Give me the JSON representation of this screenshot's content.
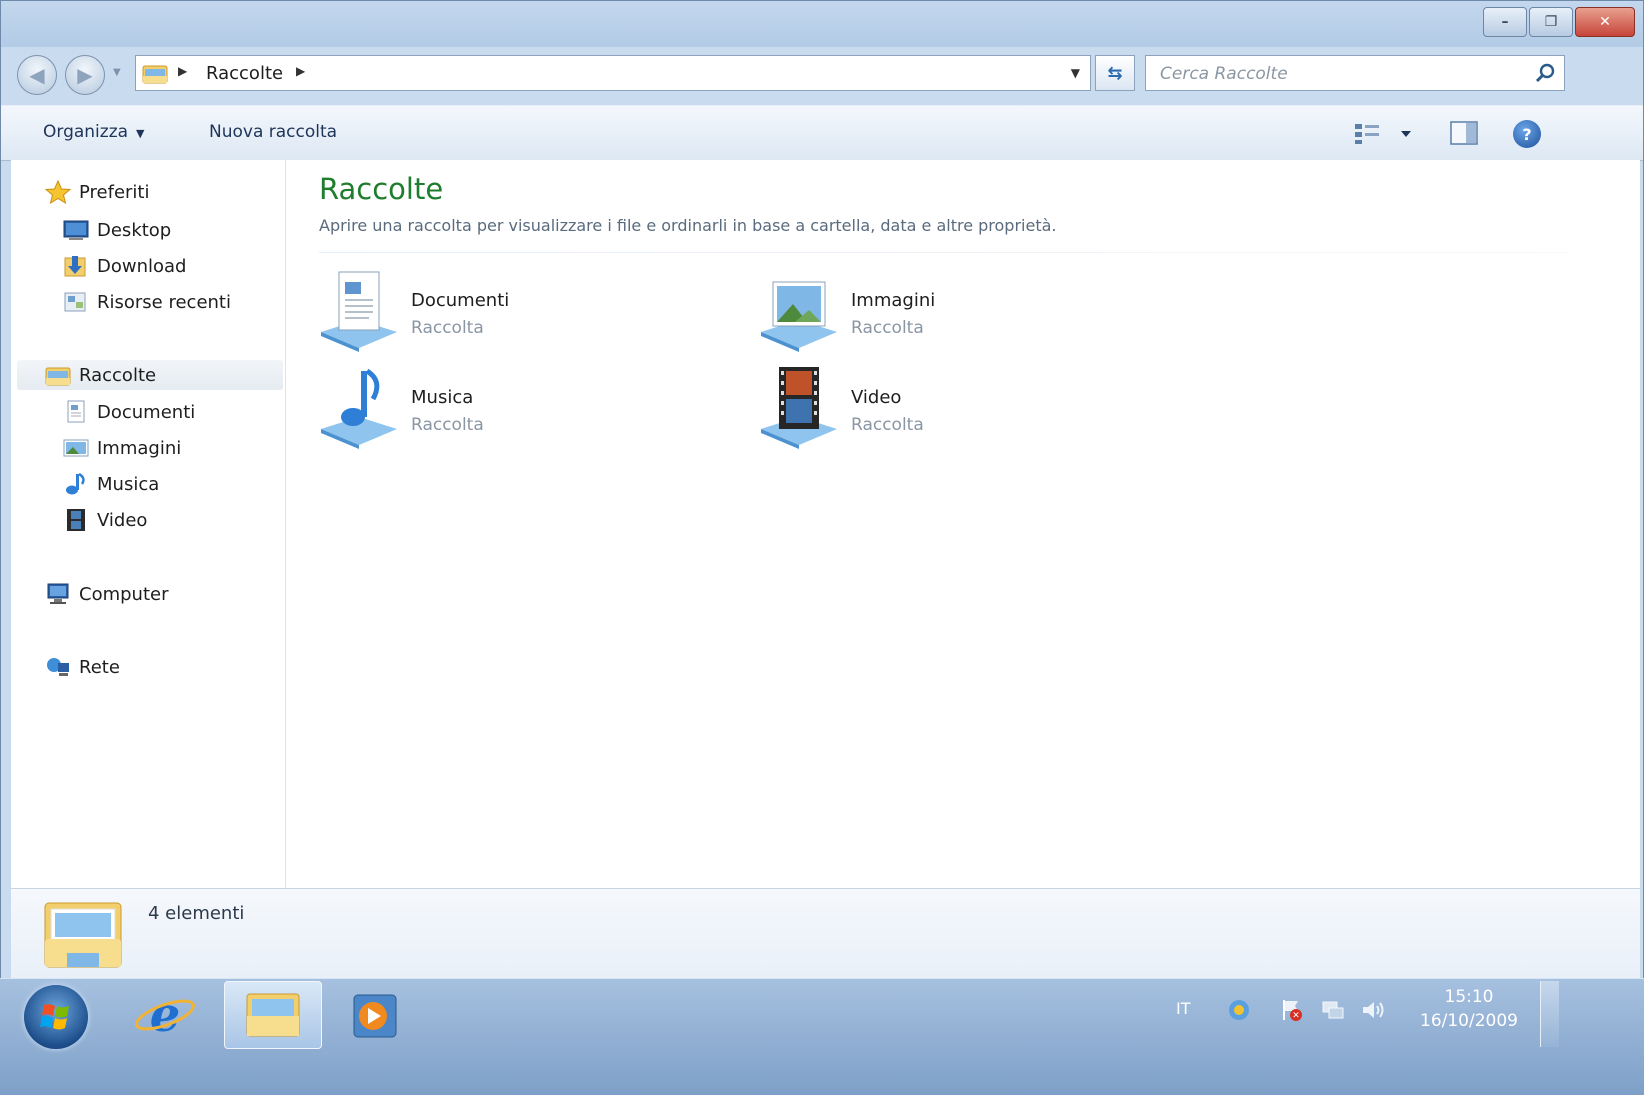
{
  "window": {
    "caption": {
      "minimize": "–",
      "maximize": "❐",
      "close": "✕"
    }
  },
  "address": {
    "breadcrumb": "Raccolte",
    "search_placeholder": "Cerca Raccolte"
  },
  "toolbar": {
    "organize": "Organizza",
    "new_library": "Nuova raccolta",
    "help": "?"
  },
  "nav": {
    "favorites": {
      "label": "Preferiti",
      "items": [
        {
          "label": "Desktop",
          "icon": "desktop-icon"
        },
        {
          "label": "Download",
          "icon": "download-icon"
        },
        {
          "label": "Risorse recenti",
          "icon": "recent-places-icon"
        }
      ]
    },
    "libraries": {
      "label": "Raccolte",
      "items": [
        {
          "label": "Documenti",
          "icon": "documents-icon"
        },
        {
          "label": "Immagini",
          "icon": "pictures-icon"
        },
        {
          "label": "Musica",
          "icon": "music-icon"
        },
        {
          "label": "Video",
          "icon": "video-icon"
        }
      ]
    },
    "computer": "Computer",
    "network": "Rete"
  },
  "content": {
    "title": "Raccolte",
    "subtitle": "Aprire una raccolta per visualizzare i file e ordinarli in base a cartella, data e altre proprietà.",
    "libraries": [
      {
        "name": "Documenti",
        "type": "Raccolta",
        "icon": "documents-library-icon"
      },
      {
        "name": "Immagini",
        "type": "Raccolta",
        "icon": "pictures-library-icon"
      },
      {
        "name": "Musica",
        "type": "Raccolta",
        "icon": "music-library-icon"
      },
      {
        "name": "Video",
        "type": "Raccolta",
        "icon": "video-library-icon"
      }
    ]
  },
  "details": {
    "count": "4 elementi"
  },
  "taskbar": {
    "language": "IT",
    "time": "15:10",
    "date": "16/10/2009"
  },
  "colors": {
    "title_green": "#1f7d2e",
    "accent_blue": "#1f4f9a",
    "taskbar": "#7ea0c8"
  }
}
